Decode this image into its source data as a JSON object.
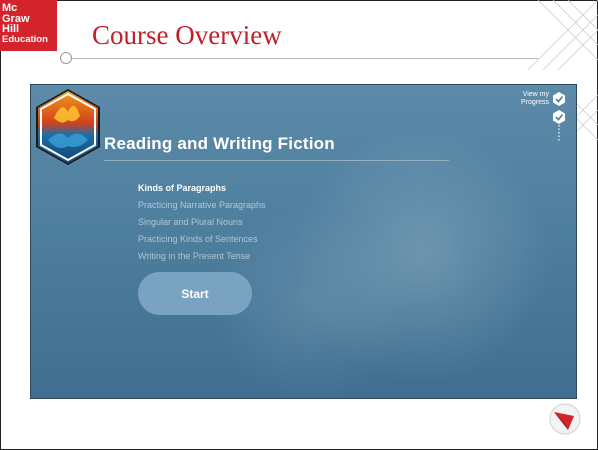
{
  "logo": {
    "line1": "Mc",
    "line2": "Graw",
    "line3": "Hill",
    "line4": "Education"
  },
  "slide": {
    "title": "Course Overview"
  },
  "course": {
    "title": "Reading and Writing Fiction",
    "lessons": [
      {
        "label": "Kinds of Paragraphs",
        "active": true
      },
      {
        "label": "Practicing Narrative Paragraphs",
        "active": false
      },
      {
        "label": "Singular and Plural Nouns",
        "active": false
      },
      {
        "label": "Practicing Kinds of Sentences",
        "active": false
      },
      {
        "label": "Writing in the Present Tense",
        "active": false
      }
    ],
    "start_label": "Start"
  },
  "progress": {
    "line1": "View my",
    "line2": "Progress"
  },
  "icons": {
    "course_image": "fire-and-water-icon",
    "progress": "checkmark-hexagon-icon",
    "corner": "red-arrow-circle-icon"
  },
  "colors": {
    "brand_red": "#d3232b",
    "panel_blue": "#4f7f9f",
    "button_blue": "#7aa3c2"
  }
}
